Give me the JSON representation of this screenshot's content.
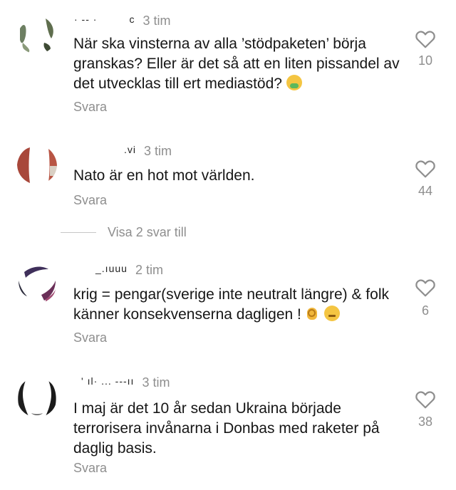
{
  "comments": [
    {
      "username": "· -- ·",
      "username_end": "c",
      "time": "3 tim",
      "text": "När ska vinsterna av alla ’stödpaketen’ börja granskas? Eller är det så att en liten pissandel av det utvecklas till ert mediastöd?",
      "emoji": [
        "nauseated-face"
      ],
      "reply_label": "Svara",
      "likes": "10"
    },
    {
      "username": ".vi",
      "time": "3 tim",
      "text": "Nato är en hot mot världen.",
      "reply_label": "Svara",
      "likes": "44",
      "view_replies": "Visa 2 svar till"
    },
    {
      "username": "_.ıuuu",
      "time": "2 tim",
      "text": "krig = pengar(sverige inte neutralt längre) & folk känner konsekvenserna dagligen !",
      "emoji": [
        "ok-hand",
        "zipper-mouth-face"
      ],
      "reply_label": "Svara",
      "likes": "6"
    },
    {
      "username": "' ıl· ... ---ıı",
      "time": "3 tim",
      "text": "I maj är det 10 år sedan Ukraina började terrorisera invånarna i Donbas med raketer på daglig basis.",
      "reply_label": "Svara",
      "likes": "38"
    }
  ],
  "colors": {
    "text": "#161616",
    "muted": "#8e8e8e",
    "heart_outline": "#8e8e8e"
  }
}
